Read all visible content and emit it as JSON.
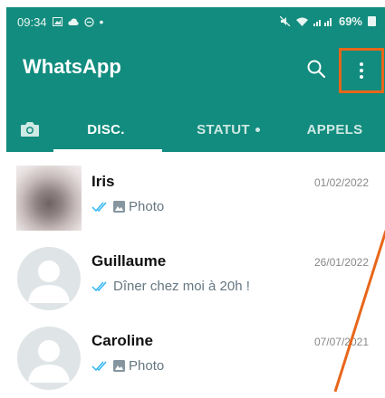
{
  "status_bar": {
    "time": "09:34",
    "battery": "69%"
  },
  "header": {
    "title": "WhatsApp"
  },
  "tabs": [
    {
      "label": "DISC.",
      "active": true
    },
    {
      "label": "STATUT",
      "active": false
    },
    {
      "label": "APPELS",
      "active": false
    }
  ],
  "chats": [
    {
      "name": "Iris",
      "date": "01/02/2022",
      "preview": "Photo",
      "type": "photo",
      "avatar": "photo"
    },
    {
      "name": "Guillaume",
      "date": "26/01/2022",
      "preview": "Dîner chez moi à 20h !",
      "type": "text",
      "avatar": "default"
    },
    {
      "name": "Caroline",
      "date": "07/07/2021",
      "preview": "Photo",
      "type": "photo",
      "avatar": "default"
    }
  ],
  "colors": {
    "brand": "#128C7E",
    "highlight": "#E8661A",
    "ticks": "#34B7F1"
  }
}
